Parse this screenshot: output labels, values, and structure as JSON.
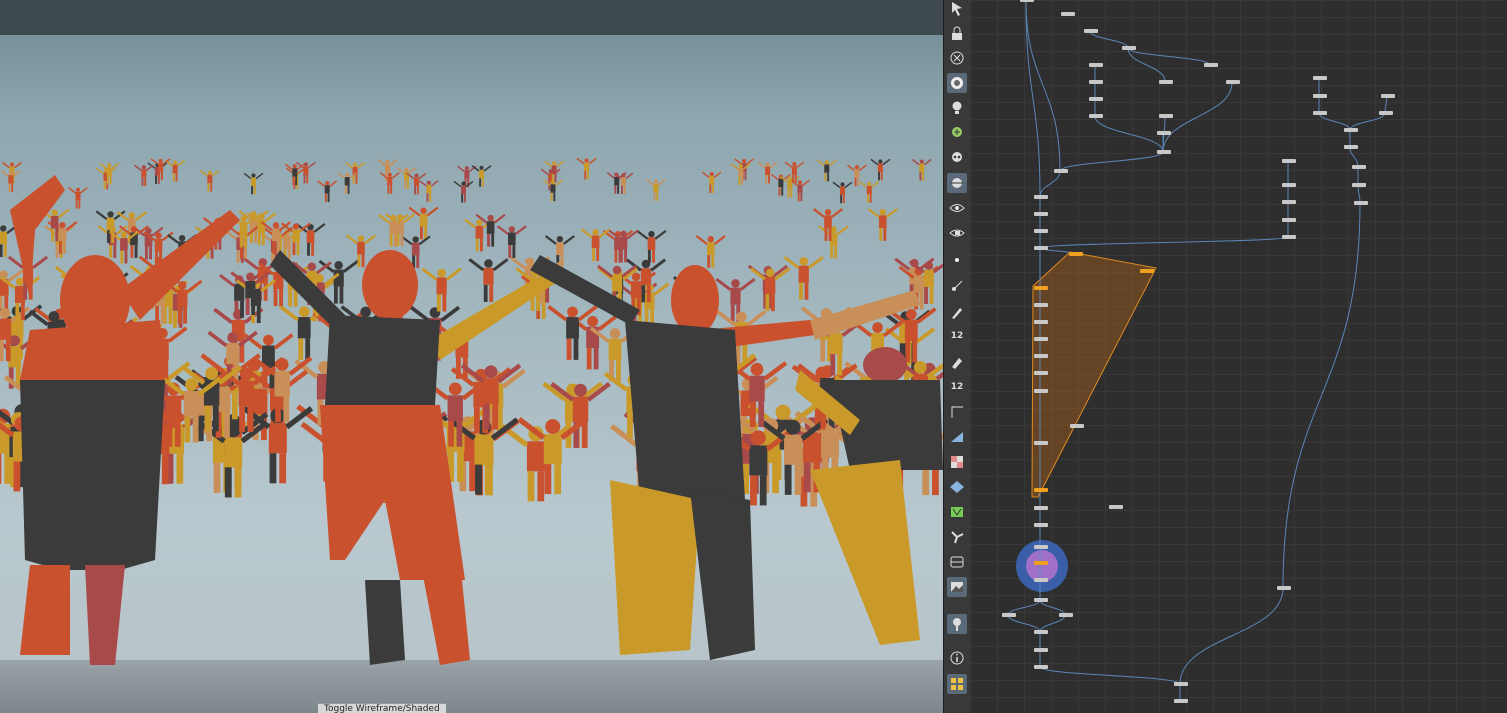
{
  "viewport": {
    "status_label": "Toggle Wireframe/Shaded",
    "colors": {
      "orange": "#c9512e",
      "dark": "#3b3b3b",
      "gold": "#c99a2a",
      "rose": "#a84a4a",
      "tan": "#c98f58"
    }
  },
  "toolbar": {
    "tools": [
      {
        "icon": "select-icon",
        "active": false
      },
      {
        "icon": "lock-icon",
        "active": false
      },
      {
        "icon": "close-circle-icon",
        "active": false
      },
      {
        "icon": "camera-icon",
        "active": true
      },
      {
        "icon": "light-bulb-icon",
        "active": false
      },
      {
        "icon": "add-light-icon",
        "active": false
      },
      {
        "icon": "skull-icon",
        "active": false
      },
      {
        "icon": "ghost-object-icon",
        "active": true
      },
      {
        "icon": "eye-icon",
        "active": false
      },
      {
        "icon": "eye-camera-icon",
        "active": false
      },
      {
        "icon": "point-icon",
        "active": false
      },
      {
        "icon": "normal-line-icon",
        "active": false
      },
      {
        "icon": "vector-pen-icon",
        "active": false
      },
      {
        "icon": "point-numbers-icon",
        "label": "12",
        "active": false
      },
      {
        "icon": "brush-icon",
        "active": false
      },
      {
        "icon": "prim-numbers-icon",
        "label": "12",
        "active": false
      },
      {
        "icon": "corner-icon",
        "active": false
      },
      {
        "icon": "shape-icon",
        "active": false
      },
      {
        "icon": "checker-icon",
        "active": false
      },
      {
        "icon": "layers-icon",
        "active": false
      },
      {
        "icon": "uv-icon",
        "active": false
      },
      {
        "icon": "fan-icon",
        "active": false
      },
      {
        "icon": "screen-icon",
        "active": false
      },
      {
        "icon": "background-image-icon",
        "active": true
      },
      {
        "icon": "pin-icon",
        "active": true
      },
      {
        "icon": "info-icon",
        "active": false
      },
      {
        "icon": "grid-view-icon",
        "active": true
      }
    ]
  },
  "network": {
    "colors": {
      "node": "#c8c8c8",
      "selected": "#f0a020",
      "wire": "#5b86b8",
      "wire_dark": "#a9c1dc"
    }
  }
}
